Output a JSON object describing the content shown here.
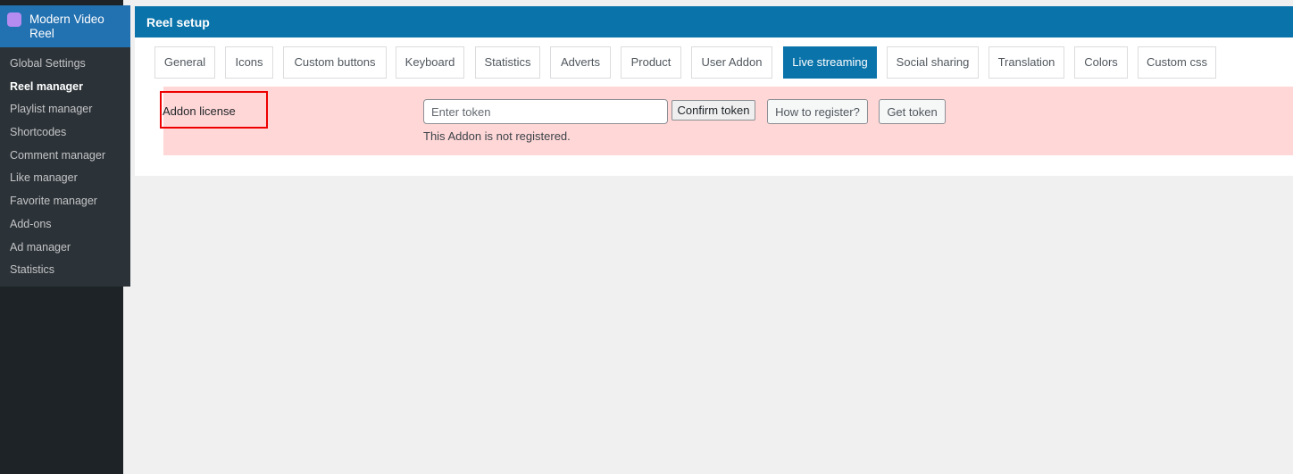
{
  "sidebar": {
    "plugin_title": "Modern Video Reel",
    "plugin_icon": "video-reel-icon",
    "items": [
      "Global Settings",
      "Reel manager",
      "Playlist manager",
      "Shortcodes",
      "Comment manager",
      "Like manager",
      "Favorite manager",
      "Add-ons",
      "Ad manager",
      "Statistics"
    ],
    "current": "Reel manager"
  },
  "header": {
    "title": "Reel setup"
  },
  "tabs": [
    "General",
    "Icons",
    "Custom buttons",
    "Keyboard",
    "Statistics",
    "Adverts",
    "Product",
    "User Addon",
    "Live streaming",
    "Social sharing",
    "Translation",
    "Colors",
    "Custom css"
  ],
  "active_tab": "Live streaming",
  "license": {
    "label": "Addon license",
    "token_placeholder": "Enter token",
    "token_value": "",
    "confirm_label": "Confirm token",
    "how_label": "How to register?",
    "get_label": "Get token",
    "status": "This Addon is not registered."
  },
  "colors": {
    "accent": "#0a73aa",
    "notice_bg": "#ffd7d7",
    "highlight_border": "#e00000"
  }
}
